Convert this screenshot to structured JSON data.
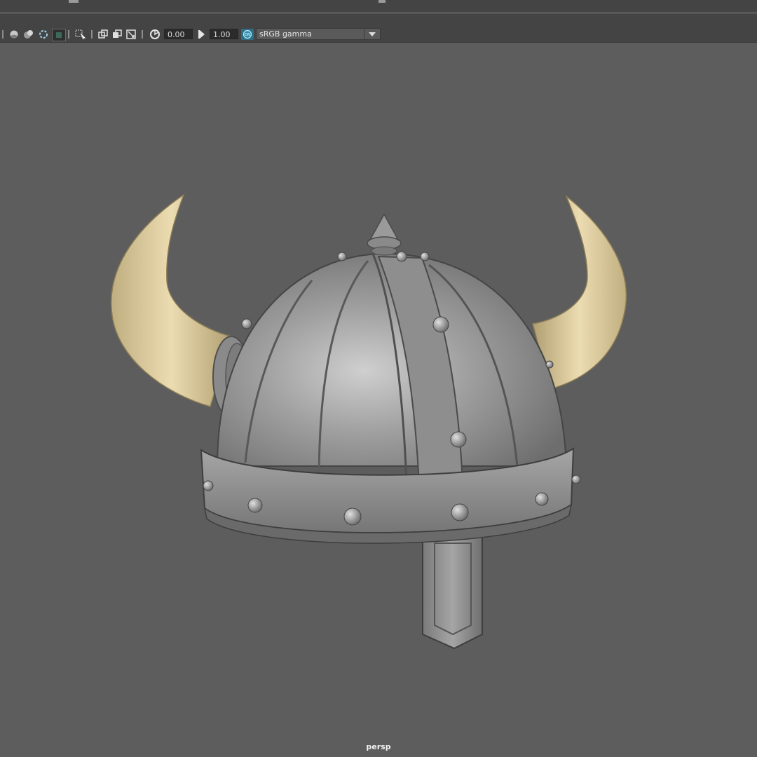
{
  "toolbar": {
    "exposure_value": "0.00",
    "gamma_value": "1.00",
    "color_space": "sRGB gamma",
    "icons": [
      "shading-smooth-icon",
      "shading-lit-icon",
      "isolate-icon",
      "display-mode-icon",
      "select-camera-icon",
      "film-gate-icon",
      "resolution-gate-icon",
      "gate-mask-icon",
      "exposure-icon",
      "gamma-icon",
      "color-management-icon",
      "dropdown-arrow-icon"
    ]
  },
  "viewport": {
    "camera_label": "persp",
    "background_color": "#5d5d5d",
    "object": "horned-helmet-model"
  },
  "colors": {
    "helmet_metal": "#8f8f8f",
    "horn": "#d9c79b",
    "toolbar_bg": "#444444"
  }
}
